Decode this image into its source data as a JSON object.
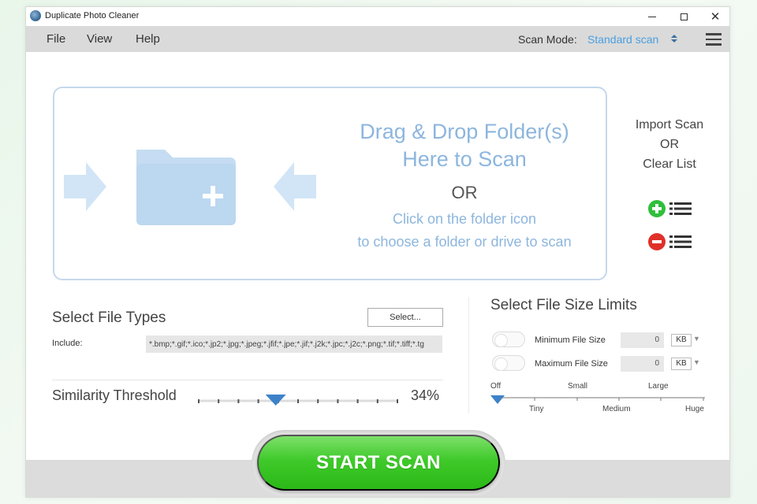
{
  "window": {
    "title": "Duplicate Photo Cleaner",
    "controls": [
      "minimize",
      "maximize",
      "close"
    ]
  },
  "menu": {
    "items": [
      "File",
      "View",
      "Help"
    ],
    "scan_mode_label": "Scan Mode:",
    "scan_mode_value": "Standard scan"
  },
  "dropzone": {
    "title_line1": "Drag & Drop Folder(s)",
    "title_line2": "Here to Scan",
    "or": "OR",
    "hint_line1": "Click on the folder icon",
    "hint_line2": "to choose a folder or drive to scan",
    "icon": "folder-plus-icon"
  },
  "import": {
    "line1": "Import Scan",
    "line2": "OR",
    "line3": "Clear List",
    "import_icon": "add-list-icon",
    "clear_icon": "remove-list-icon"
  },
  "file_types": {
    "title": "Select File Types",
    "select_button": "Select...",
    "include_label": "Include:",
    "include_value": "*.bmp;*.gif;*.ico;*.jp2;*.jpg;*.jpeg;*.jfif;*.jpe;*.jif;*.j2k;*.jpc;*.j2c;*.png;*.tif;*.tiff;*.tg"
  },
  "similarity": {
    "label": "Similarity Threshold",
    "value_text": "34%",
    "value": 34
  },
  "size_limits": {
    "title": "Select File Size Limits",
    "min_label": "Minimum File Size",
    "max_label": "Maximum File Size",
    "min_value": "0",
    "max_value": "0",
    "min_unit": "KB",
    "max_unit": "KB",
    "scale_top": [
      "Off",
      "Small",
      "Large"
    ],
    "scale_bottom": [
      "Tiny",
      "Medium",
      "Huge"
    ]
  },
  "actions": {
    "start_scan": "START SCAN"
  },
  "colors": {
    "accent_blue": "#4a9fe0",
    "drop_blue": "#8db6de",
    "start_green": "#3fca2a",
    "add_green": "#2fbf3a",
    "remove_red": "#e0302a"
  }
}
